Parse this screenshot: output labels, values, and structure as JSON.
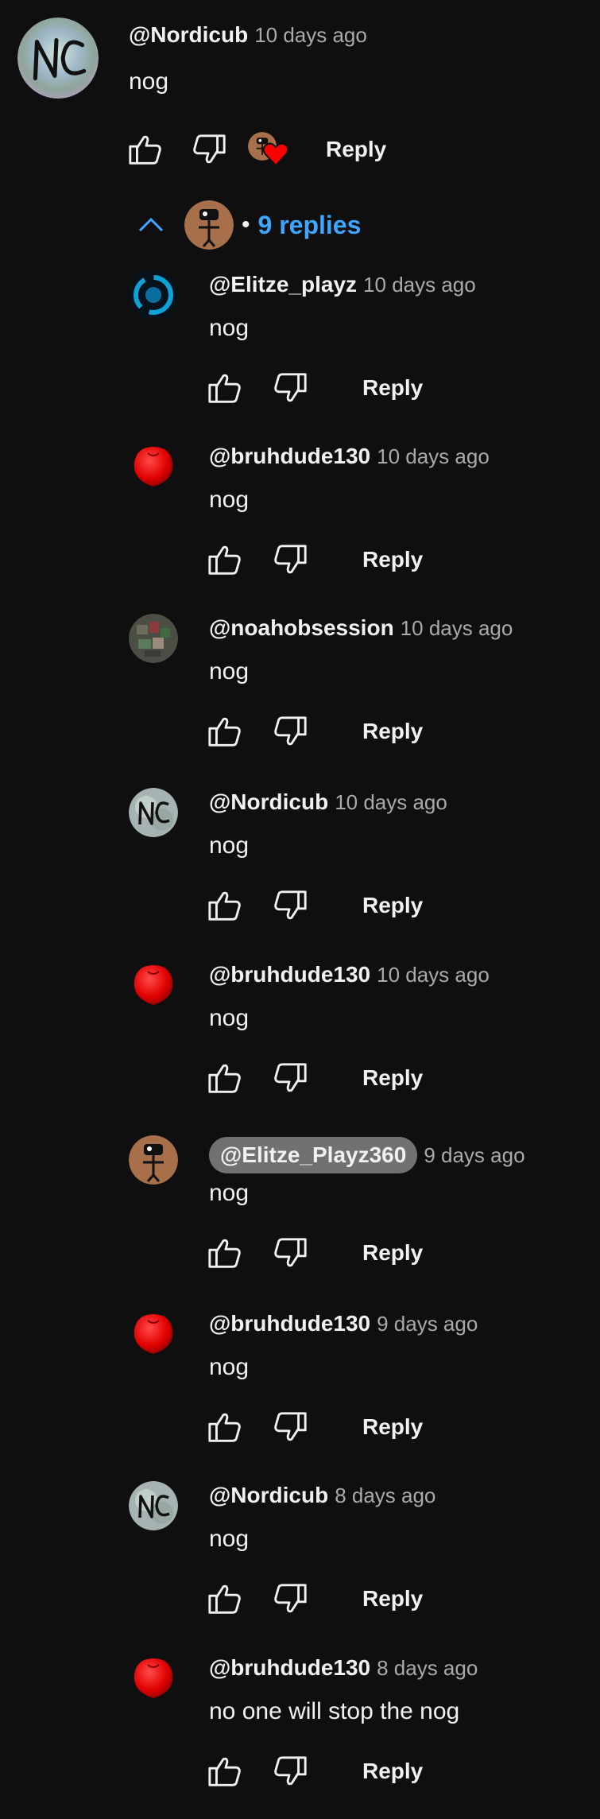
{
  "top_comment": {
    "author": "@Nordicub",
    "time": "10 days ago",
    "text": "nog",
    "reply_label": "Reply"
  },
  "replies_toggle": {
    "count_label": "9 replies",
    "dot": "•"
  },
  "replies": [
    {
      "author": "@Elitze_playz",
      "time": "10 days ago",
      "text": "nog",
      "reply_label": "Reply",
      "avatar": "blue-circle",
      "chip": false
    },
    {
      "author": "@bruhdude130",
      "time": "10 days ago",
      "text": "nog",
      "reply_label": "Reply",
      "avatar": "red-ball",
      "chip": false
    },
    {
      "author": "@noahobsession",
      "time": "10 days ago",
      "text": "nog",
      "reply_label": "Reply",
      "avatar": "pixel",
      "chip": false
    },
    {
      "author": "@Nordicub",
      "time": "10 days ago",
      "text": "nog",
      "reply_label": "Reply",
      "avatar": "nc",
      "chip": false
    },
    {
      "author": "@bruhdude130",
      "time": "10 days ago",
      "text": "nog",
      "reply_label": "Reply",
      "avatar": "red-ball",
      "chip": false
    },
    {
      "author": "@Elitze_Playz360",
      "time": "9 days ago",
      "text": "nog",
      "reply_label": "Reply",
      "avatar": "brown-robot",
      "chip": true
    },
    {
      "author": "@bruhdude130",
      "time": "9 days ago",
      "text": "nog",
      "reply_label": "Reply",
      "avatar": "red-ball",
      "chip": false
    },
    {
      "author": "@Nordicub",
      "time": "8 days ago",
      "text": "nog",
      "reply_label": "Reply",
      "avatar": "nc",
      "chip": false
    },
    {
      "author": "@bruhdude130",
      "time": "8 days ago",
      "text": "no one will stop the nog",
      "reply_label": "Reply",
      "avatar": "red-ball",
      "chip": false
    }
  ],
  "colors": {
    "background": "#0f0f0f",
    "text": "#f1f1f1",
    "secondary_text": "#aaaaaa",
    "link_blue": "#3ea6ff",
    "heart_red": "#ff0000",
    "chip_gray": "#717171"
  }
}
